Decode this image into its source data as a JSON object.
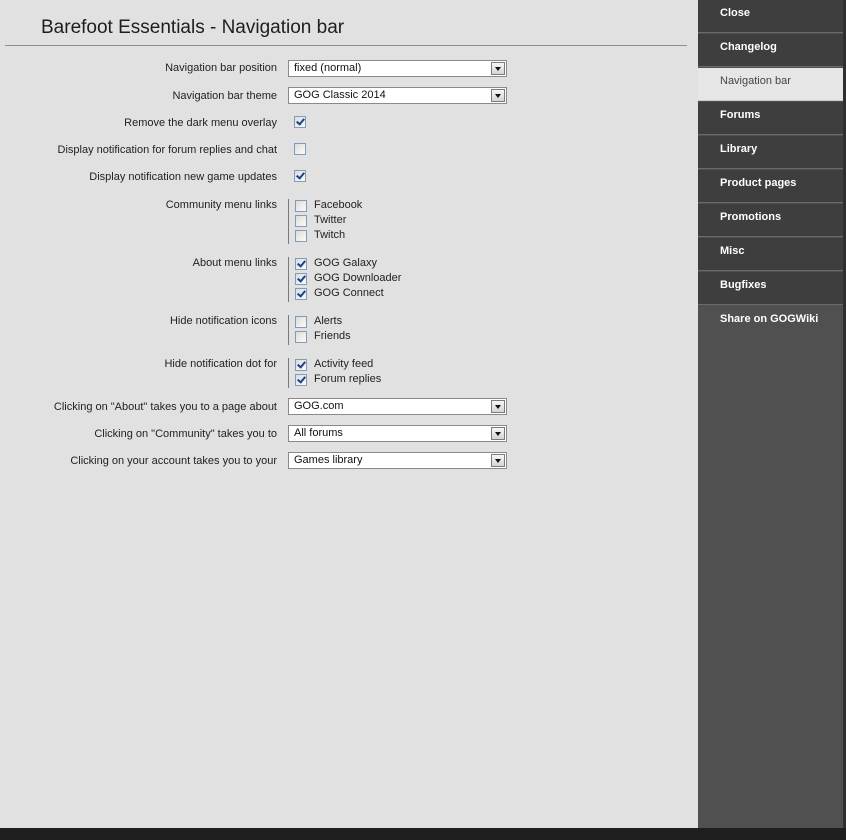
{
  "page": {
    "title": "Barefoot Essentials - Navigation bar"
  },
  "settings": {
    "nav_position": {
      "label": "Navigation bar position",
      "value": "fixed (normal)"
    },
    "nav_theme": {
      "label": "Navigation bar theme",
      "value": "GOG Classic 2014"
    },
    "remove_overlay": {
      "label": "Remove the dark menu overlay",
      "checked": true
    },
    "notify_forum": {
      "label": "Display notification for forum replies and chat",
      "checked": false
    },
    "notify_updates": {
      "label": "Display notification new game updates",
      "checked": true
    },
    "community_links": {
      "label": "Community menu links",
      "items": [
        {
          "label": "Facebook",
          "checked": false
        },
        {
          "label": "Twitter",
          "checked": false
        },
        {
          "label": "Twitch",
          "checked": false
        }
      ]
    },
    "about_links": {
      "label": "About menu links",
      "items": [
        {
          "label": "GOG Galaxy",
          "checked": true
        },
        {
          "label": "GOG Downloader",
          "checked": true
        },
        {
          "label": "GOG Connect",
          "checked": true
        }
      ]
    },
    "hide_icons": {
      "label": "Hide notification icons",
      "items": [
        {
          "label": "Alerts",
          "checked": false
        },
        {
          "label": "Friends",
          "checked": false
        }
      ]
    },
    "hide_dot": {
      "label": "Hide notification dot for",
      "items": [
        {
          "label": "Activity feed",
          "checked": true
        },
        {
          "label": "Forum replies",
          "checked": true
        }
      ]
    },
    "about_target": {
      "label": "Clicking on \"About\" takes you to a page about",
      "value": "GOG.com"
    },
    "community_target": {
      "label": "Clicking on \"Community\" takes you to",
      "value": "All forums"
    },
    "account_target": {
      "label": "Clicking on your account takes you to your",
      "value": "Games library"
    }
  },
  "sidebar": {
    "items": [
      {
        "label": "Close"
      },
      {
        "label": "Changelog"
      },
      {
        "label": "Navigation bar",
        "active": true
      },
      {
        "label": "Forums"
      },
      {
        "label": "Library"
      },
      {
        "label": "Product pages"
      },
      {
        "label": "Promotions"
      },
      {
        "label": "Misc"
      },
      {
        "label": "Bugfixes"
      },
      {
        "label": "Share on GOGWiki"
      }
    ]
  }
}
